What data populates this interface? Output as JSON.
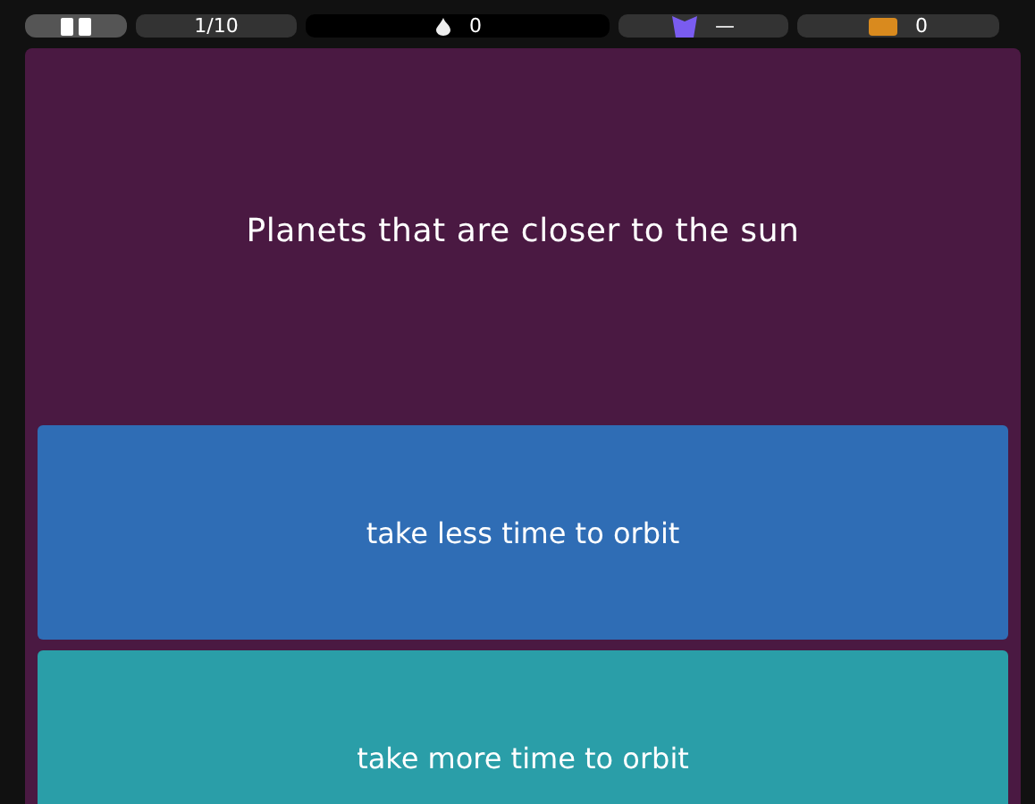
{
  "top_bar": {
    "progress": "1/10",
    "streak": "0",
    "powerup": "—",
    "coins": "0"
  },
  "question": "Planets that are closer to the sun",
  "answers": [
    {
      "text": "take less time to orbit",
      "color": "#2f6db5"
    },
    {
      "text": "take more time to orbit",
      "color": "#2a9ea8"
    }
  ]
}
